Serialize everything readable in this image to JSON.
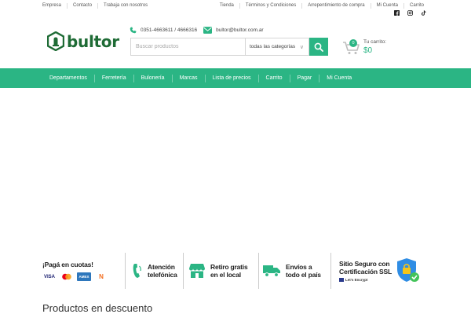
{
  "topbar": {
    "left_links": [
      "Empresa",
      "Contacto",
      "Trabaja con nosotros"
    ],
    "right_links": [
      "Tienda",
      "Términos y Condiciones",
      "Arrepentimiento de compra",
      "Mi Cuenta",
      "Carrito"
    ],
    "social_icons": [
      "facebook-icon",
      "instagram-icon",
      "tiktok-icon"
    ]
  },
  "header": {
    "logo_text": "bultor",
    "phone": "0351-4663611 / 4666316",
    "email": "bultor@bultor.com.ar",
    "search_placeholder": "Buscar productos",
    "category_select": "todas las categorías",
    "cart_label": "Tu carrito:",
    "cart_amount": "$0",
    "cart_count": "0"
  },
  "nav": {
    "items": [
      "Departamentos",
      "Ferretería",
      "Bulonería",
      "Marcas",
      "Lista de precios",
      "Carrito",
      "Pagar",
      "Mi Cuenta"
    ]
  },
  "features": {
    "pay": "¡Pagá en cuotas!",
    "cards": [
      "VISA",
      "MC",
      "AMEX",
      "N"
    ],
    "support_line1": "Atención",
    "support_line2": "telefónica",
    "pickup_line1": "Retiro gratis",
    "pickup_line2": "en el local",
    "shipping_line1": "Envíos a",
    "shipping_line2": "todo el país",
    "ssl_line1": "Sitio Seguro con",
    "ssl_line2": "Certificación SSL",
    "ssl_provider": "Let's Encrypt"
  },
  "sections": {
    "discount_title": "Productos en descuento"
  },
  "colors": {
    "brand_green": "#2bb584",
    "logo_green": "#1e6b35"
  }
}
